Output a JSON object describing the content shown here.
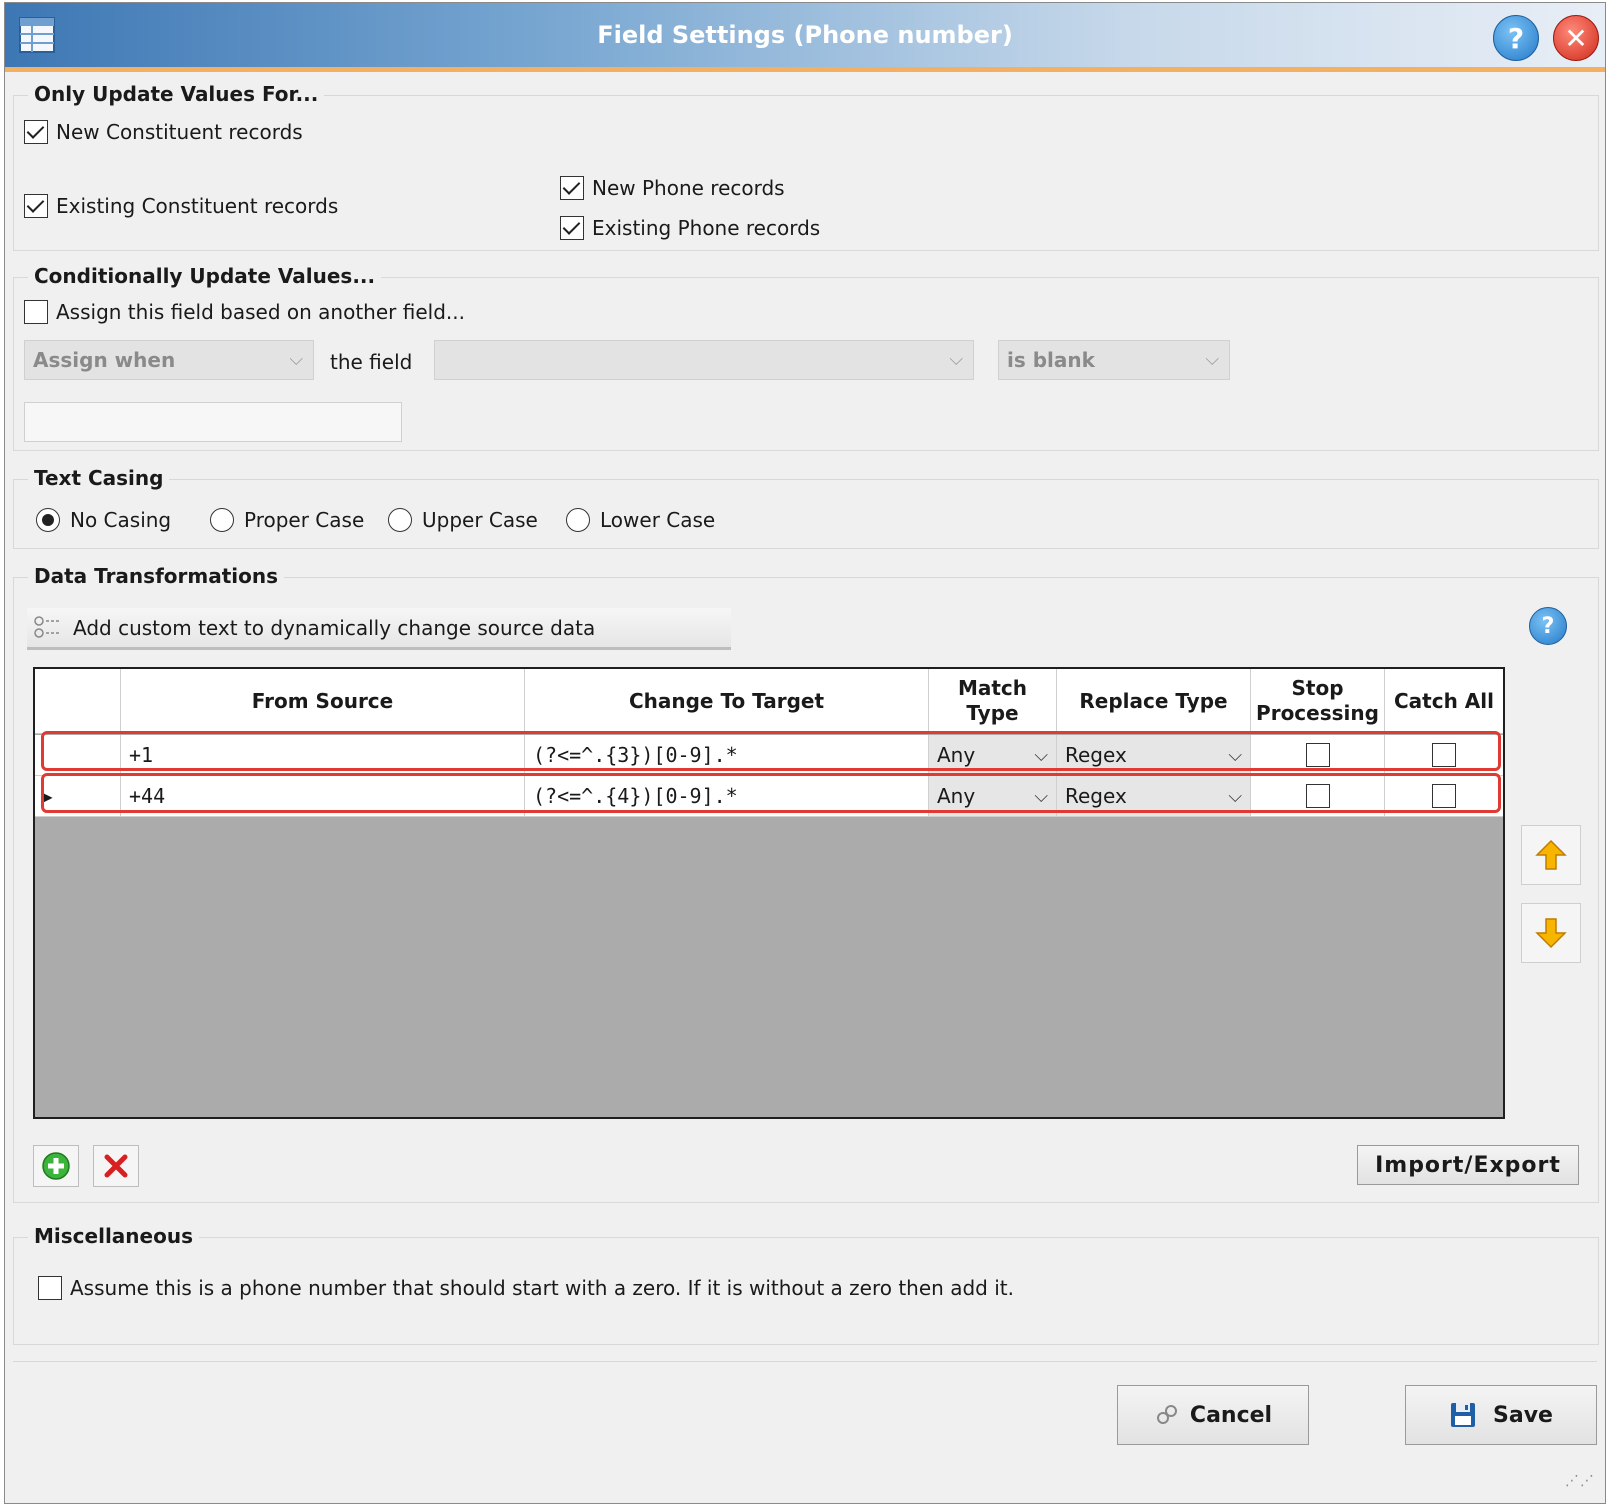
{
  "window": {
    "title": "Field Settings (Phone number)"
  },
  "only_update": {
    "title": "Only Update Values For...",
    "new_constituent": "New Constituent records",
    "existing_constituent": "Existing Constituent records",
    "new_phone": "New Phone records",
    "existing_phone": "Existing Phone records"
  },
  "conditional": {
    "title": "Conditionally Update Values...",
    "assign_label": "Assign this field based on another field...",
    "assign_when": "Assign when",
    "the_field": "the field",
    "field_value": "",
    "condition": "is blank",
    "value_text": ""
  },
  "casing": {
    "title": "Text Casing",
    "options": [
      "No Casing",
      "Proper Case",
      "Upper Case",
      "Lower Case"
    ],
    "selected": "No Casing"
  },
  "transform": {
    "title": "Data Transformations",
    "custom_text_button": "Add custom text to dynamically change source data",
    "columns": [
      "From Source",
      "Change To Target",
      "Match Type",
      "Replace Type",
      "Stop Processing",
      "Catch All"
    ],
    "rows": [
      {
        "from": "+1",
        "to": "(?<=^.{3})[0-9].*",
        "match": "Any",
        "replace": "Regex",
        "stop": false,
        "catch_all": false
      },
      {
        "from": "+44",
        "to": "(?<=^.{4})[0-9].*",
        "match": "Any",
        "replace": "Regex",
        "stop": false,
        "catch_all": false
      }
    ],
    "import_export": "Import/Export"
  },
  "misc": {
    "title": "Miscellaneous",
    "zero_label": "Assume this is a phone number that should start with a zero. If it is without a zero then add it."
  },
  "footer": {
    "cancel": "Cancel",
    "save": "Save"
  },
  "colors": {
    "accent": "#3d77b4",
    "highlight": "#e03a32",
    "title_underline": "#f3b062"
  }
}
